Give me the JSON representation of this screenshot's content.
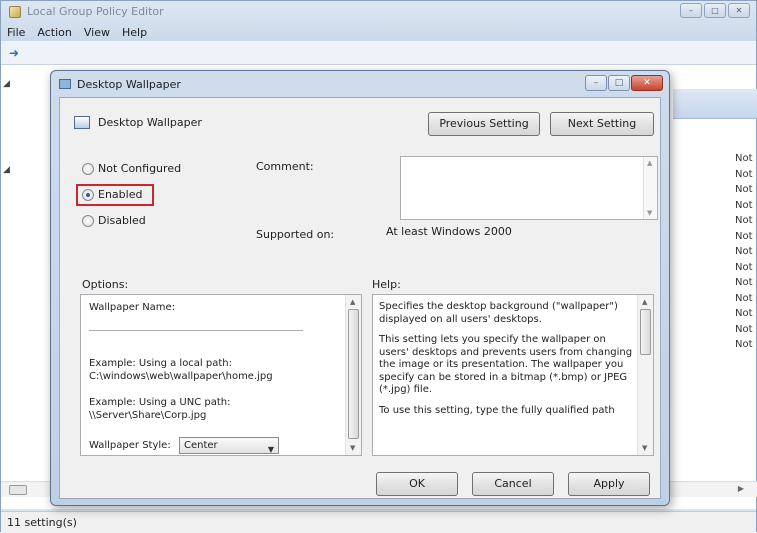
{
  "main_window": {
    "title": "Local Group Policy Editor",
    "menu": [
      "File",
      "Action",
      "View",
      "Help"
    ],
    "right_column_values": [
      "Not",
      "Not",
      "Not",
      "Not",
      "Not",
      "Not",
      "Not",
      "Not",
      "Not",
      "Not",
      "Not",
      "Not",
      "Not"
    ],
    "status_text": "11 setting(s)"
  },
  "dialog": {
    "title": "Desktop Wallpaper",
    "setting_name": "Desktop Wallpaper",
    "previous_button": "Previous Setting",
    "next_button": "Next Setting",
    "radio_options": [
      {
        "label": "Not Configured",
        "checked": false
      },
      {
        "label": "Enabled",
        "checked": true
      },
      {
        "label": "Disabled",
        "checked": false
      }
    ],
    "comment_label": "Comment:",
    "comment_value": "",
    "supported_label": "Supported on:",
    "supported_value": "At least Windows 2000",
    "options_label": "Options:",
    "help_label": "Help:",
    "options": {
      "wallpaper_name_label": "Wallpaper Name:",
      "wallpaper_name_value": "",
      "example_local_title": "Example: Using a local path:",
      "example_local_path": "C:\\windows\\web\\wallpaper\\home.jpg",
      "example_unc_title": "Example: Using a UNC path:",
      "example_unc_path": "\\\\Server\\Share\\Corp.jpg",
      "style_label": "Wallpaper Style:",
      "style_value": "Center"
    },
    "help_paragraphs": [
      "Specifies the desktop background (\"wallpaper\") displayed on all users' desktops.",
      "This setting lets you specify the wallpaper on users' desktops and prevents users from changing the image or its presentation. The wallpaper you specify can be stored in a bitmap (*.bmp) or JPEG (*.jpg) file.",
      "To use this setting, type the fully qualified path"
    ],
    "ok_button": "OK",
    "cancel_button": "Cancel",
    "apply_button": "Apply"
  },
  "colors": {
    "highlight_border": "#c72a2a",
    "close_button": "#c6442f"
  }
}
